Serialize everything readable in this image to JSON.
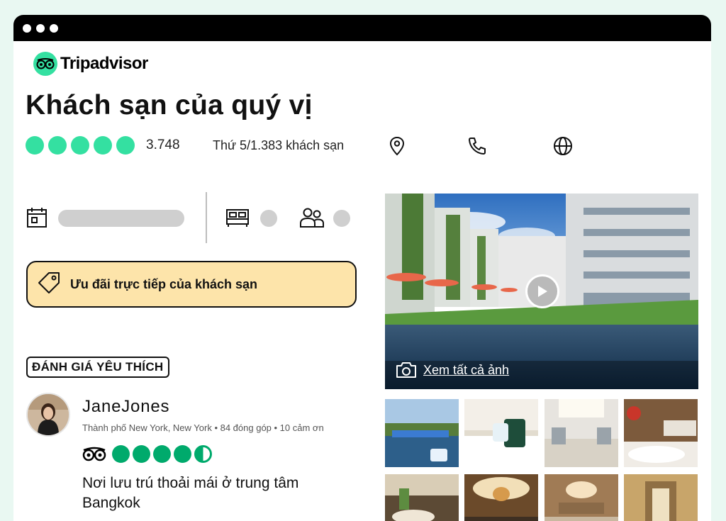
{
  "logo": {
    "text": "Tripadvisor"
  },
  "hotel": {
    "title": "Khách sạn của quý vị",
    "rating_bubbles": 5,
    "review_count": "3.748",
    "rank": "Thứ 5/1.383 khách sạn"
  },
  "deal": {
    "label": "Ưu đãi trực tiếp của khách sạn"
  },
  "favorite_badge": "ĐÁNH GIÁ YÊU THÍCH",
  "review": {
    "name": "JaneJones",
    "meta": "Thành phố New York, New York • 84 đóng góp • 10 cảm ơn",
    "rating": 4.5,
    "title": "Nơi lưu trú thoải mái ở trung tâm Bangkok"
  },
  "gallery": {
    "see_all_label": "Xem tất cả ảnh"
  },
  "colors": {
    "brand_green": "#34e0a1",
    "review_green": "#00aa6c",
    "deal_yellow": "#fde4aa"
  },
  "icons": [
    "tripadvisor-owl-icon",
    "map-pin-icon",
    "phone-icon",
    "globe-icon",
    "calendar-icon",
    "bed-icon",
    "guests-icon",
    "tag-icon",
    "camera-icon",
    "play-icon"
  ]
}
